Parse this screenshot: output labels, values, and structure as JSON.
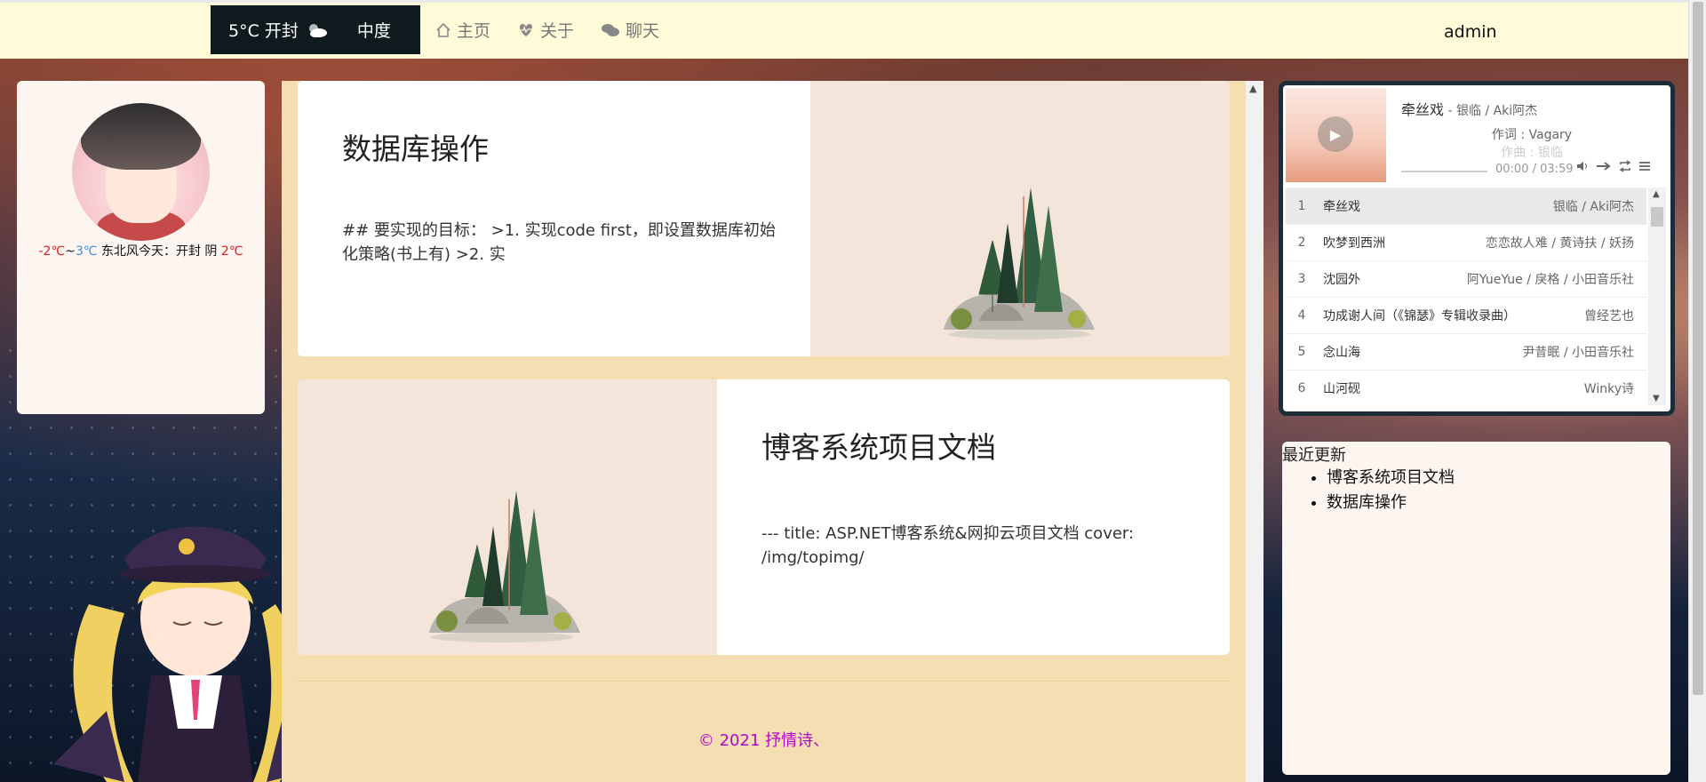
{
  "nav": {
    "weather": "5°C 开封",
    "weather_icon": "partly-cloudy-icon",
    "brand": "中度",
    "links": [
      {
        "label": "主页",
        "icon": "home-icon"
      },
      {
        "label": "关于",
        "icon": "heartbeat-icon"
      },
      {
        "label": "聊天",
        "icon": "chat-icon"
      }
    ],
    "user": "admin"
  },
  "profile": {
    "low": "-2℃",
    "sep": "~",
    "high": "3℃",
    "wind": " 东北风",
    "today_label": "今天：开封 阴 ",
    "today_temp": "2℃"
  },
  "posts": [
    {
      "title": "数据库操作",
      "excerpt": "## 要实现的目标： >1. 实现code first，即设置数据库初始化策略(书上有) >2. 实"
    },
    {
      "title": "博客系统项目文档",
      "excerpt": "--- title: ASP.NET博客系统&网抑云项目文档 cover: /img/topimg/"
    }
  ],
  "footer": "© 2021 抒情诗、",
  "player": {
    "song": "牵丝戏",
    "artist": " - 银临 / Aki阿杰",
    "lyric1": "作词 : Vagary",
    "lyric2": "作曲 : 银临",
    "time": "00:00 / 03:59",
    "progress": 0,
    "playlist": [
      {
        "n": "1",
        "title": "牵丝戏",
        "artist": "银临 / Aki阿杰"
      },
      {
        "n": "2",
        "title": "吹梦到西洲",
        "artist": "恋恋故人难 / 黄诗扶 / 妖扬"
      },
      {
        "n": "3",
        "title": "沈园外",
        "artist": "阿YueYue / 戾格 / 小田音乐社"
      },
      {
        "n": "4",
        "title": "功成谢人间（《锦瑟》专辑收录曲）",
        "artist": "曾经艺也"
      },
      {
        "n": "5",
        "title": "念山海",
        "artist": "尹昔眠 / 小田音乐社"
      },
      {
        "n": "6",
        "title": "山河砚",
        "artist": "Winky诗"
      }
    ]
  },
  "recent": {
    "heading": "最近更新",
    "items": [
      "博客系统项目文档",
      "数据库操作"
    ]
  }
}
